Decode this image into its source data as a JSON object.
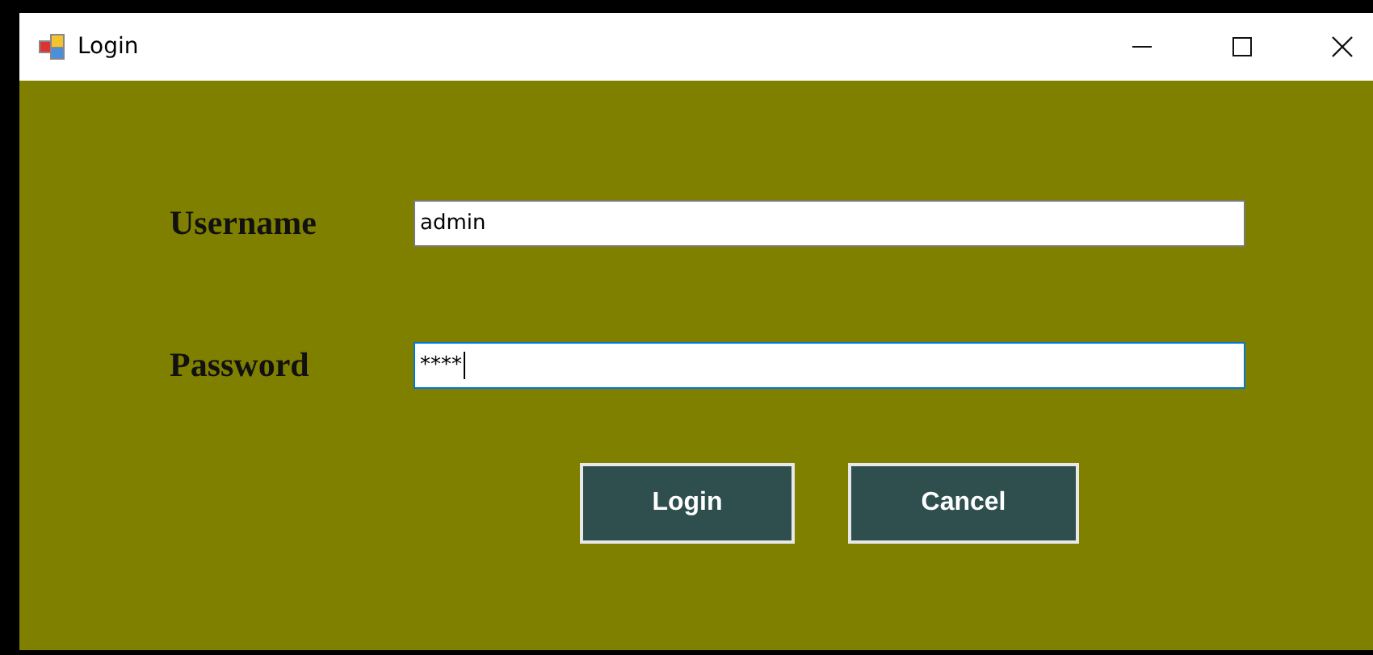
{
  "window": {
    "title": "Login"
  },
  "fields": [
    {
      "label": "Username",
      "value": "admin",
      "focused": false
    },
    {
      "label": "Password",
      "value": "****",
      "focused": true
    }
  ],
  "buttons": [
    "Login",
    "Cancel"
  ]
}
